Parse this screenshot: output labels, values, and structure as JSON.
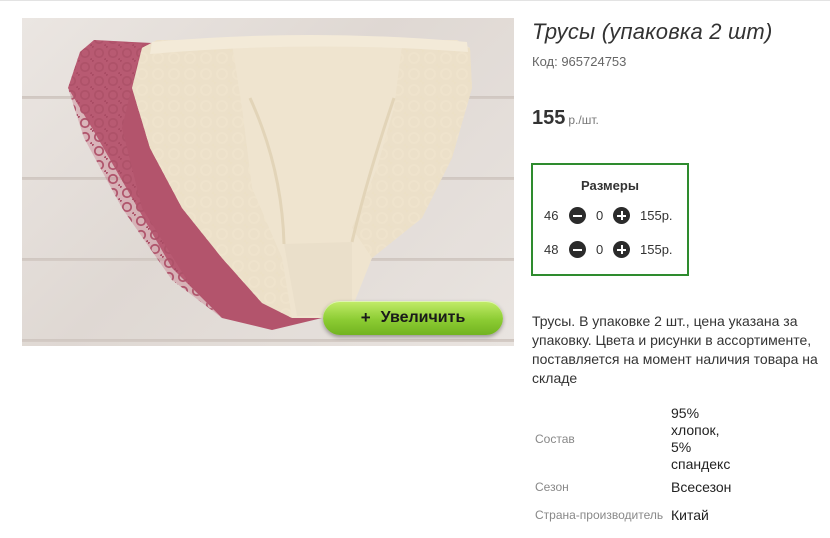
{
  "product": {
    "title": "Трусы (упаковка 2 шт)",
    "code": "Код: 965724753",
    "price_value": "155",
    "price_unit": "р./шт.",
    "zoom_button": {
      "icon": "plus-icon",
      "icon_glyph": "+",
      "label": "Увеличить",
      "color": "#8ccc33"
    },
    "image": {
      "alt": "Трусы (упаковка 2 шт)"
    }
  },
  "sizes": {
    "title": "Размеры",
    "border_color": "#2e8b2e",
    "rows": [
      {
        "size": "46",
        "qty": "0",
        "price": "155р."
      },
      {
        "size": "48",
        "qty": "0",
        "price": "155р."
      }
    ]
  },
  "description": "Трусы. В упаковке 2 шт., цена указана за упаковку. Цвета и рисунки в ассортименте, поставляется на момент наличия товара на складе",
  "specs": [
    {
      "label": "Состав",
      "value": "95% хлопок, 5% спандекс"
    },
    {
      "label": "Сезон",
      "value": "Всесезон"
    },
    {
      "label": "Страна-производитель",
      "value": "Китай"
    }
  ]
}
